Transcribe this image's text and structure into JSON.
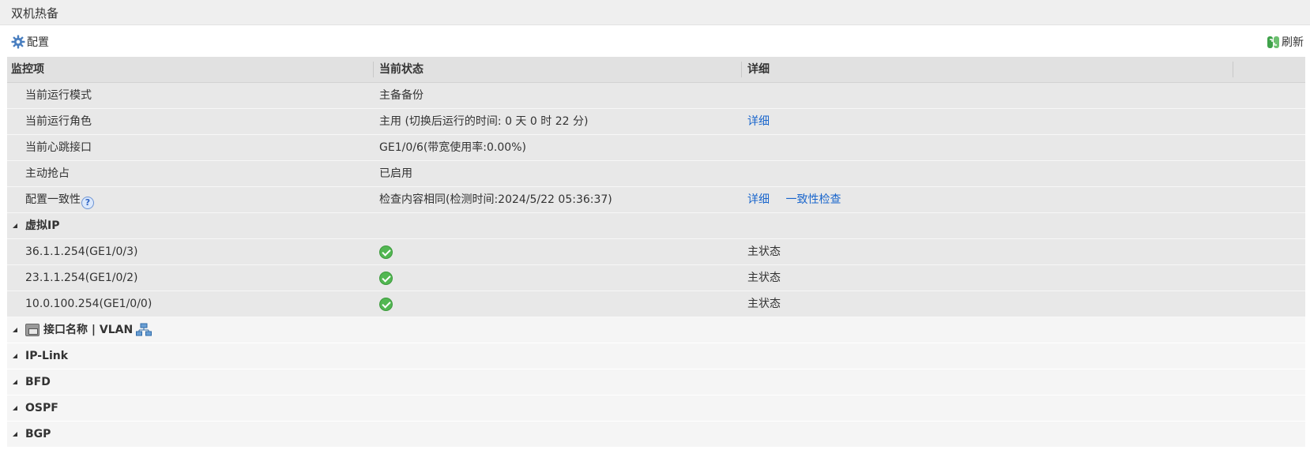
{
  "page": {
    "title": "双机热备"
  },
  "toolbar": {
    "config_label": "配置",
    "refresh_label": "刷新"
  },
  "table": {
    "headers": [
      "监控项",
      "当前状态",
      "详细"
    ],
    "rows": [
      {
        "item": "当前运行模式",
        "status": "主备备份",
        "detail": ""
      },
      {
        "item": "当前运行角色",
        "status": "主用 (切换后运行的时间: 0 天 0 时 22 分)",
        "detail": "详细"
      },
      {
        "item": "当前心跳接口",
        "status": "GE1/0/6(带宽使用率:0.00%)",
        "detail": ""
      },
      {
        "item": "主动抢占",
        "status": "已启用",
        "detail": ""
      },
      {
        "item": "配置一致性",
        "status": "检查内容相同(检测时间:2024/5/22 05:36:37)",
        "detail": "详细",
        "detail2": "一致性检查"
      }
    ],
    "virtual_ip": {
      "label": "虚拟IP",
      "rows": [
        {
          "item": "36.1.1.254(GE1/0/3)",
          "status": "ok",
          "detail": "主状态"
        },
        {
          "item": "23.1.1.254(GE1/0/2)",
          "status": "ok",
          "detail": "主状态"
        },
        {
          "item": "10.0.100.254(GE1/0/0)",
          "status": "ok",
          "detail": "主状态"
        }
      ]
    },
    "groups": [
      {
        "label": "接口名称 | VLAN"
      },
      {
        "label": "IP-Link"
      },
      {
        "label": "BFD"
      },
      {
        "label": "OSPF"
      },
      {
        "label": "BGP"
      }
    ]
  },
  "colors": {
    "link": "#1a66cc",
    "ok": "#52b752",
    "header_bg": "#e1e1e1"
  }
}
